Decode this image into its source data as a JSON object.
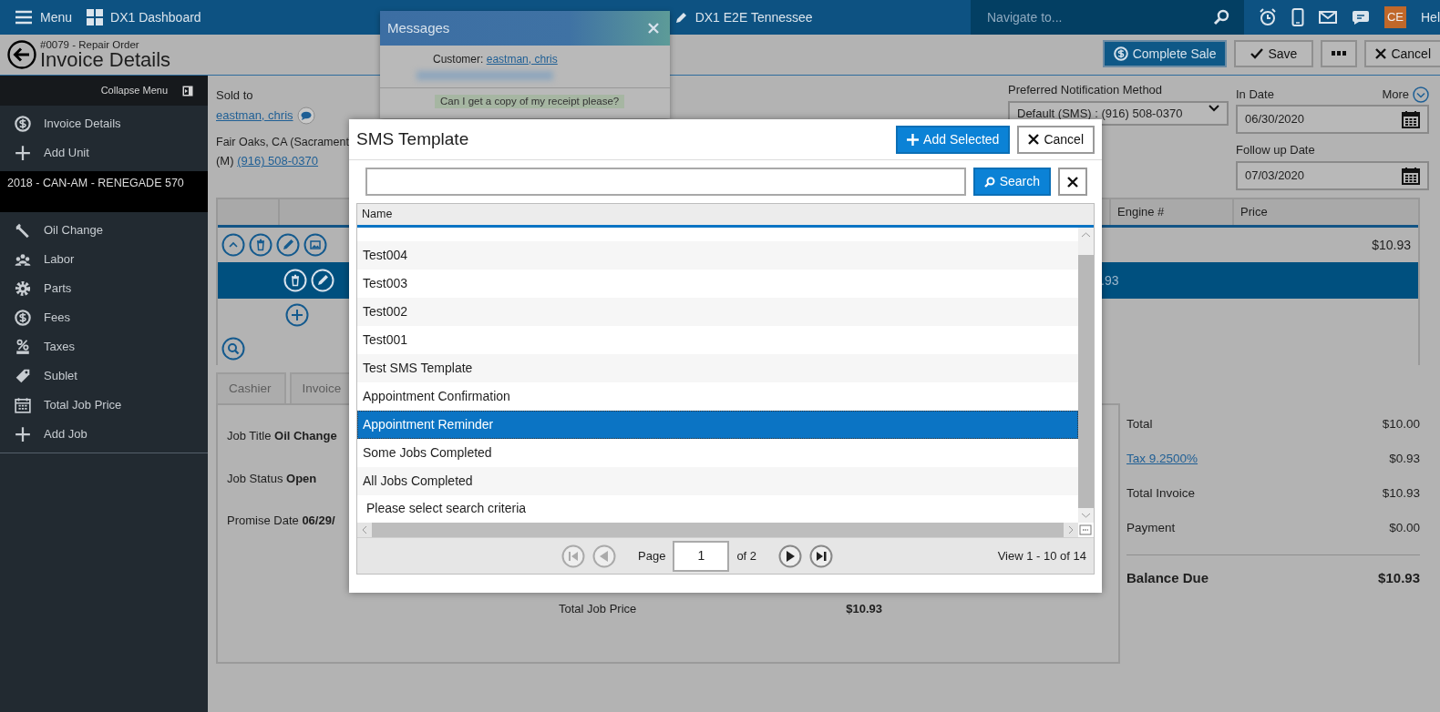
{
  "top_bar": {
    "menu_label": "Menu",
    "dashboard_label": "DX1 Dashboard",
    "store_name": "DX1 E2E Tennessee",
    "search": {
      "placeholder": "Navigate to..."
    },
    "avatar": "CE",
    "help": "Hel"
  },
  "header": {
    "subtitle": "#0079 - Repair Order",
    "title": "Invoice Details",
    "buttons": [
      {
        "kind": "sale",
        "label": "Complete Sale"
      },
      {
        "kind": "save",
        "label": "Save"
      },
      {
        "kind": "more"
      },
      {
        "kind": "cancel",
        "label": "Cancel"
      }
    ]
  },
  "sidebar": {
    "collapse_label": "Collapse Menu",
    "top_items": [
      {
        "kind": "dollar",
        "label": "Invoice Details"
      },
      {
        "kind": "plus",
        "label": "Add Unit"
      }
    ],
    "unit": "2018 - CAN-AM - RENEGADE 570",
    "job_items": [
      {
        "kind": "wrench",
        "label": "Oil Change"
      },
      {
        "kind": "people",
        "label": "Labor"
      },
      {
        "kind": "gear",
        "label": "Parts"
      },
      {
        "kind": "dollar",
        "label": "Fees"
      },
      {
        "kind": "percent",
        "label": "Taxes"
      },
      {
        "kind": "tag",
        "label": "Sublet"
      },
      {
        "kind": "calendar",
        "label": "Total Job Price"
      },
      {
        "kind": "plus",
        "label": "Add Job"
      }
    ]
  },
  "customer": {
    "label": "Sold to",
    "name": "eastman, chris",
    "address": "Fair Oaks, CA (Sacrament",
    "phone_prefix": "(M)",
    "phone": "(916) 508-0370"
  },
  "notification": {
    "label": "Preferred Notification Method",
    "value": "Default (SMS) : (916) 508-0370"
  },
  "dates": {
    "more": "More",
    "in_date": {
      "label": "In Date",
      "value": "06/30/2020"
    },
    "follow_up": {
      "label": "Follow up Date",
      "value": "07/03/2020"
    }
  },
  "jobs_table": {
    "columns": [
      "Engine #",
      "Price"
    ],
    "rows": [
      {
        "kind": "job",
        "selected": false,
        "price": "$10.93"
      },
      {
        "kind": "line",
        "selected": true,
        "price": ".93"
      },
      {
        "kind": "add",
        "selected": false
      },
      {
        "kind": "search",
        "selected": false
      }
    ]
  },
  "tabs": [
    {
      "label": "Cashier",
      "selected": false
    },
    {
      "label": "Invoice",
      "selected": false
    }
  ],
  "job_details": {
    "fields": [
      "Job Title **Oil Change**",
      "Job Status **Open**",
      "Promise Date **06/29/**"
    ],
    "total_label": "Total Job Price",
    "total_value": "$10.93"
  },
  "summary": [
    {
      "kind": "plain",
      "label": "Total",
      "value": "$10.00"
    },
    {
      "kind": "link",
      "label": "Tax 9.2500%",
      "value": "$0.93"
    },
    {
      "kind": "plain",
      "label": "Total Invoice",
      "value": "$10.93"
    },
    {
      "kind": "plain",
      "label": "Payment",
      "value": "$0.00"
    },
    {
      "kind": "total",
      "label": "Balance Due",
      "value": "$10.93"
    }
  ],
  "messages": {
    "title": "Messages",
    "customer_label": "Customer:",
    "customer_name": "eastman, chris",
    "last_message": "Can I get a copy of my receipt please?"
  },
  "sms_dialog": {
    "title": "SMS Template",
    "buttons": [
      {
        "kind": "add",
        "label": "Add Selected"
      },
      {
        "kind": "cancel",
        "label": "Cancel"
      }
    ],
    "search": {
      "button": "Search"
    },
    "column": "Name",
    "rows": [
      {
        "name": "Test004",
        "selected": false
      },
      {
        "name": "Test003",
        "selected": false
      },
      {
        "name": "Test002",
        "selected": false
      },
      {
        "name": "Test001",
        "selected": false
      },
      {
        "name": "Test SMS Template",
        "selected": false
      },
      {
        "name": "Appointment Confirmation",
        "selected": false
      },
      {
        "name": "Appointment Reminder",
        "selected": true
      },
      {
        "name": "Some Jobs Completed",
        "selected": false
      },
      {
        "name": "All Jobs Completed",
        "selected": false
      }
    ],
    "empty_message": "Please select search criteria",
    "pager": {
      "page_label": "Page",
      "page": "1",
      "of": "of 2",
      "summary": "View 1 - 10 of 14"
    }
  }
}
